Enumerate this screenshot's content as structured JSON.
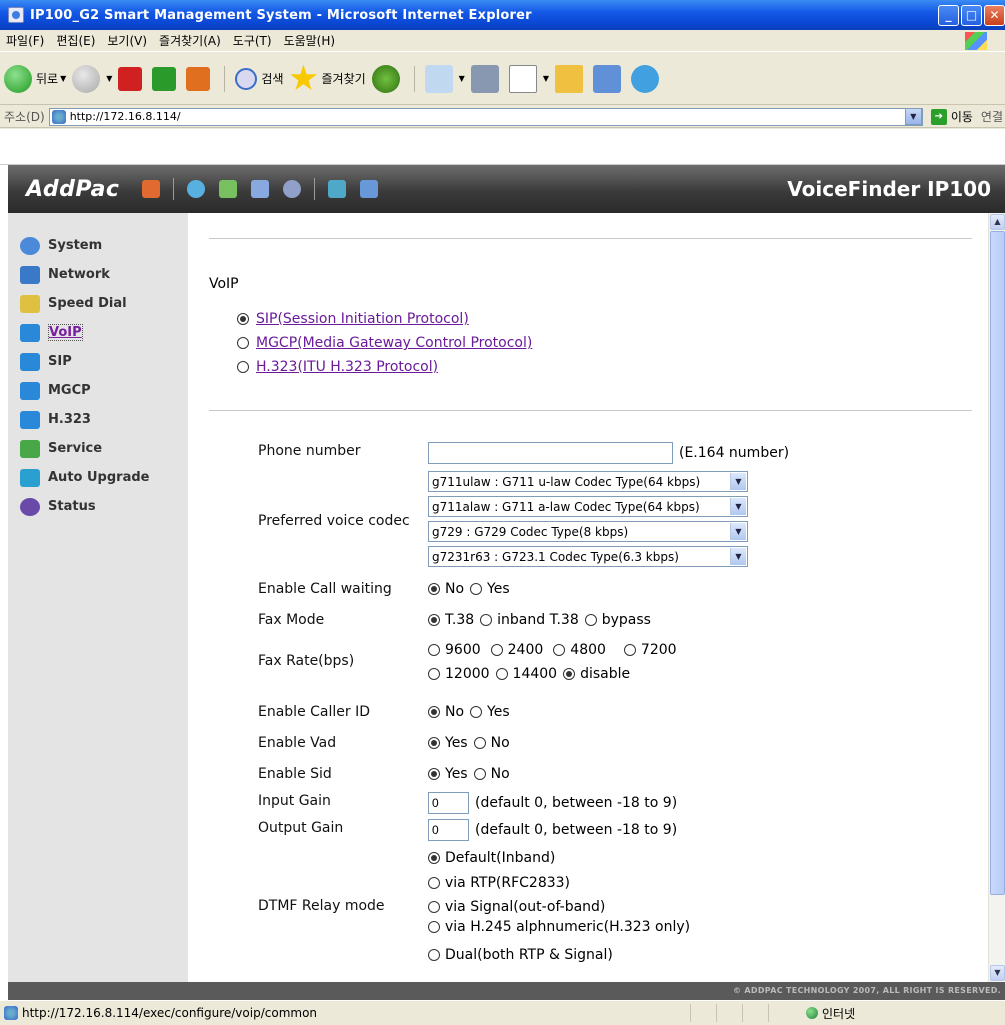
{
  "window": {
    "title": "IP100_G2 Smart Management System - Microsoft Internet Explorer",
    "min": "_",
    "max": "□",
    "close": "✕"
  },
  "menu": [
    "파일(F)",
    "편집(E)",
    "보기(V)",
    "즐겨찾기(A)",
    "도구(T)",
    "도움말(H)"
  ],
  "toolbar": {
    "back": "뒤로",
    "search": "검색",
    "favorites": "즐겨찾기"
  },
  "address": {
    "label": "주소(D)",
    "url": "http://172.16.8.114/",
    "go": "이동",
    "links": "연결"
  },
  "header": {
    "logo": "AddPac",
    "product": "VoiceFinder IP100"
  },
  "sidebar": {
    "items": [
      {
        "label": "System",
        "icon": "globe-icon",
        "color": "#4a8ad8"
      },
      {
        "label": "Network",
        "icon": "network-icon",
        "color": "#3a78c8"
      },
      {
        "label": "Speed Dial",
        "icon": "speed-dial-icon",
        "color": "#e0c040"
      },
      {
        "label": "VoIP",
        "icon": "people-icon",
        "color": "#2a88d8"
      },
      {
        "label": "SIP",
        "icon": "people-icon",
        "color": "#2a88d8"
      },
      {
        "label": "MGCP",
        "icon": "people-icon",
        "color": "#2a88d8"
      },
      {
        "label": "H.323",
        "icon": "people-icon",
        "color": "#2a88d8"
      },
      {
        "label": "Service",
        "icon": "service-icon",
        "color": "#48a848"
      },
      {
        "label": "Auto Upgrade",
        "icon": "upgrade-icon",
        "color": "#2aa0d0"
      },
      {
        "label": "Status",
        "icon": "status-icon",
        "color": "#6a4aa8"
      }
    ]
  },
  "content": {
    "title": "VoIP",
    "protocols": [
      {
        "label": "SIP(Session Initiation Protocol)",
        "selected": true
      },
      {
        "label": "MGCP(Media Gateway Control Protocol)",
        "selected": false
      },
      {
        "label": "H.323(ITU H.323 Protocol)",
        "selected": false
      }
    ],
    "phone": {
      "label": "Phone number",
      "value": "",
      "hint": "(E.164 number)"
    },
    "codec": {
      "label": "Preferred voice codec",
      "options": [
        "g711ulaw : G711 u-law Codec Type(64 kbps)",
        "g711alaw : G711 a-law Codec Type(64 kbps)",
        "g729 : G729 Codec Type(8 kbps)",
        "g7231r63 : G723.1 Codec Type(6.3 kbps)"
      ]
    },
    "call_waiting": {
      "label": "Enable Call waiting",
      "options": [
        "No",
        "Yes"
      ]
    },
    "fax_mode": {
      "label": "Fax Mode",
      "options": [
        "T.38",
        "inband T.38",
        "bypass"
      ]
    },
    "fax_rate": {
      "label": "Fax Rate(bps)",
      "row1": [
        "9600",
        "2400",
        "4800",
        "7200"
      ],
      "row2": [
        "12000",
        "14400",
        "disable"
      ]
    },
    "caller_id": {
      "label": "Enable Caller ID",
      "options": [
        "No",
        "Yes"
      ]
    },
    "vad": {
      "label": "Enable Vad",
      "options": [
        "Yes",
        "No"
      ]
    },
    "sid": {
      "label": "Enable Sid",
      "options": [
        "Yes",
        "No"
      ]
    },
    "input_gain": {
      "label": "Input Gain",
      "value": "0",
      "hint": "(default 0, between -18 to 9)"
    },
    "output_gain": {
      "label": "Output Gain",
      "value": "0",
      "hint": "(default 0, between -18 to 9)"
    },
    "dtmf": {
      "label": "DTMF Relay mode",
      "options": [
        "Default(Inband)",
        "via RTP(RFC2833)",
        "via Signal(out-of-band)",
        "via H.245 alphnumeric(H.323 only)",
        "Dual(both RTP & Signal)"
      ]
    }
  },
  "footer": {
    "copyright": "© ADDPAC TECHNOLOGY 2007, ALL RIGHT IS RESERVED."
  },
  "statusbar": {
    "url": "http://172.16.8.114/exec/configure/voip/common",
    "zone": "인터넷"
  }
}
